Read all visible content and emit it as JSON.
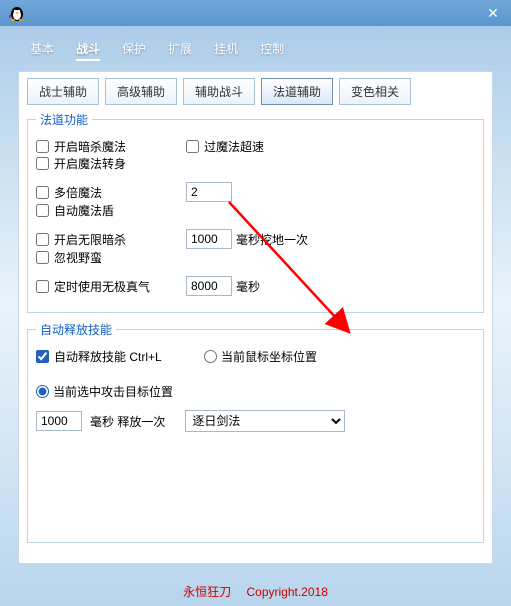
{
  "titlebar": {
    "close_glyph": "✕"
  },
  "tabs_top": [
    "基本",
    "战斗",
    "保护",
    "扩展",
    "挂机",
    "控制"
  ],
  "tabs_top_active": 1,
  "subtabs": [
    "战士辅助",
    "高级辅助",
    "辅助战斗",
    "法道辅助",
    "变色相关"
  ],
  "subtabs_active": 3,
  "group1": {
    "legend": "法道功能",
    "chk_open_assassin": "开启暗杀魔法",
    "chk_overmagic_speed": "过魔法超速",
    "chk_open_magic_transform": "开启魔法转身",
    "chk_multi_magic": "多倍魔法",
    "multi_value": "2",
    "chk_auto_magic_shield": "自动魔法盾",
    "chk_open_infinite_assassin": "开启无限暗杀",
    "dig_ms_value": "1000",
    "dig_suffix": "毫秒挖地一次",
    "chk_ignore_barbarian": "忽视野蛮",
    "chk_timed_qi": "定时使用无极真气",
    "timed_value": "8000",
    "timed_suffix": "毫秒"
  },
  "group2": {
    "legend": "自动释放技能",
    "chk_auto_cast": "自动释放技能 Ctrl+L",
    "radio_cursor_pos": "当前鼠标坐标位置",
    "radio_target_pos": "当前选中攻击目标位置",
    "interval_value": "1000",
    "interval_suffix": "毫秒 释放一次",
    "skill_selected": "逐日剑法"
  },
  "footer": {
    "brand": "永恒狂刀",
    "copyright": "Copyright.2018"
  }
}
